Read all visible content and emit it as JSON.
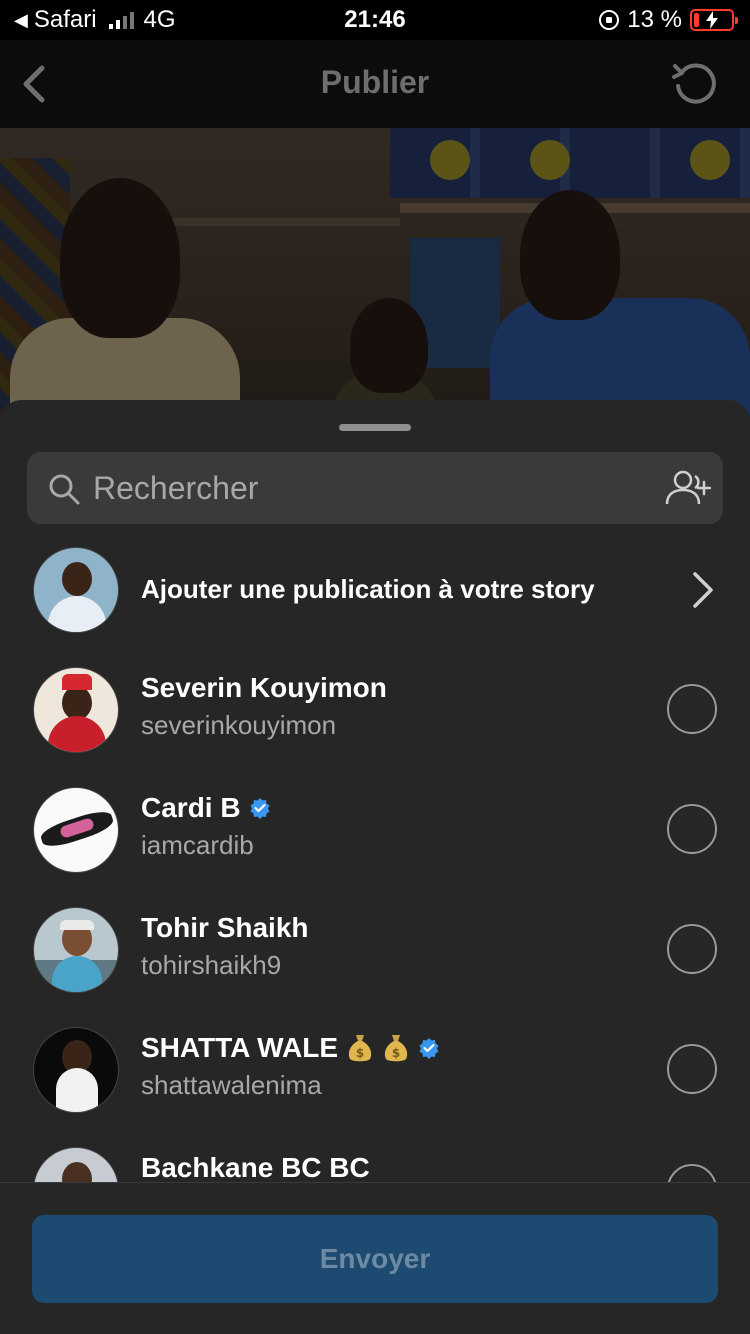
{
  "status_bar": {
    "back_app": "Safari",
    "network": "4G",
    "time": "21:46",
    "battery_percent": "13 %"
  },
  "header": {
    "title": "Publier"
  },
  "search": {
    "placeholder": "Rechercher"
  },
  "story": {
    "label": "Ajouter une publication à votre story"
  },
  "contacts": [
    {
      "name": "Severin Kouyimon",
      "handle": "severinkouyimon",
      "verified": false,
      "selected": false
    },
    {
      "name": "Cardi B",
      "handle": "iamcardib",
      "verified": true,
      "selected": false
    },
    {
      "name": "Tohir Shaikh",
      "handle": "tohirshaikh9",
      "verified": false,
      "selected": false
    },
    {
      "name": "SHATTA WALE",
      "handle": "shattawalenima",
      "verified": true,
      "selected": false,
      "emojis": [
        "money-bag",
        "money-bag"
      ]
    },
    {
      "name": "Bachkane BC BC",
      "handle": "",
      "verified": false,
      "selected": false
    }
  ],
  "footer": {
    "send_label": "Envoyer"
  },
  "colors": {
    "sheet_bg": "#262626",
    "search_bg": "#3a3a3a",
    "send_bg": "#1c4a70",
    "verified": "#3897f0",
    "battery_low": "#ff3b30"
  }
}
